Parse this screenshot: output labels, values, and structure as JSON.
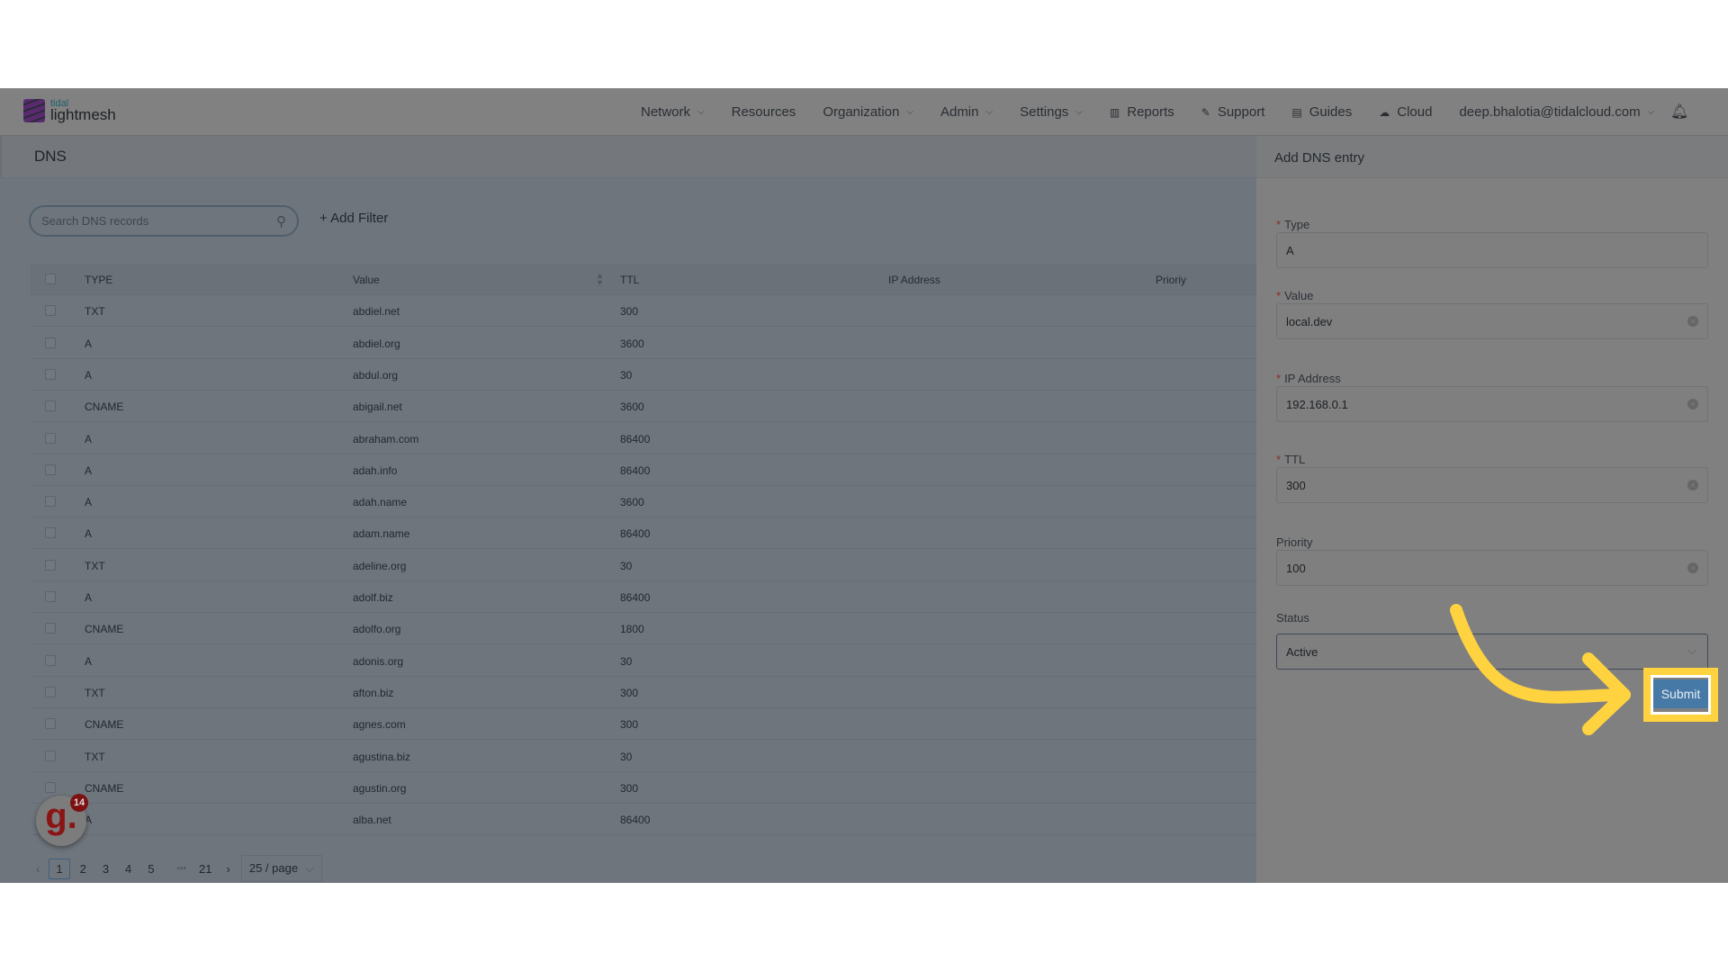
{
  "brand": {
    "line1": "tidal",
    "line2": "lightmesh"
  },
  "nav": [
    {
      "label": "Network",
      "dropdown": true
    },
    {
      "label": "Resources",
      "dropdown": false
    },
    {
      "label": "Organization",
      "dropdown": true
    },
    {
      "label": "Admin",
      "dropdown": true
    },
    {
      "label": "Settings",
      "dropdown": true
    },
    {
      "label": "Reports",
      "icon": "bar-chart-icon"
    },
    {
      "label": "Support",
      "icon": "wrench-icon"
    },
    {
      "label": "Guides",
      "icon": "book-icon"
    },
    {
      "label": "Cloud",
      "icon": "cloud-icon"
    },
    {
      "label": "deep.bhalotia@tidalcloud.com",
      "dropdown": true
    }
  ],
  "page_title": "DNS",
  "search": {
    "placeholder": "Search DNS records"
  },
  "add_filter": "+ Add Filter",
  "table": {
    "columns": [
      "TYPE",
      "Value",
      "TTL",
      "IP Address",
      "Prioriy"
    ],
    "rows": [
      [
        "TXT",
        "abdiel.net",
        "300"
      ],
      [
        "A",
        "abdiel.org",
        "3600"
      ],
      [
        "A",
        "abdul.org",
        "30"
      ],
      [
        "CNAME",
        "abigail.net",
        "3600"
      ],
      [
        "A",
        "abraham.com",
        "86400"
      ],
      [
        "A",
        "adah.info",
        "86400"
      ],
      [
        "A",
        "adah.name",
        "3600"
      ],
      [
        "A",
        "adam.name",
        "86400"
      ],
      [
        "TXT",
        "adeline.org",
        "30"
      ],
      [
        "A",
        "adolf.biz",
        "86400"
      ],
      [
        "CNAME",
        "adolfo.org",
        "1800"
      ],
      [
        "A",
        "adonis.org",
        "30"
      ],
      [
        "TXT",
        "afton.biz",
        "300"
      ],
      [
        "CNAME",
        "agnes.com",
        "300"
      ],
      [
        "TXT",
        "agustina.biz",
        "30"
      ],
      [
        "CNAME",
        "agustin.org",
        "300"
      ],
      [
        "A",
        "alba.net",
        "86400"
      ]
    ]
  },
  "pagination": {
    "pages": [
      "1",
      "2",
      "3",
      "4",
      "5"
    ],
    "ellipsis": "•••",
    "last": "21",
    "current": "1",
    "page_size": "25 / page"
  },
  "panel": {
    "title": "Add DNS entry",
    "fields": [
      {
        "label": "Type",
        "required": true,
        "value": "A",
        "clearable": false
      },
      {
        "label": "Value",
        "required": true,
        "value": "local.dev",
        "clearable": true
      },
      {
        "label": "IP Address",
        "required": true,
        "value": "192.168.0.1",
        "clearable": true
      },
      {
        "label": "TTL",
        "required": true,
        "value": "300",
        "clearable": true
      },
      {
        "label": "Priority",
        "required": false,
        "value": "100",
        "clearable": true
      }
    ],
    "status": {
      "label": "Status",
      "value": "Active"
    },
    "submit": "Submit"
  },
  "badge": {
    "letter": "g.",
    "count": "14"
  },
  "colors": {
    "submit": "#4679a6",
    "highlight": "#ffd23f"
  }
}
